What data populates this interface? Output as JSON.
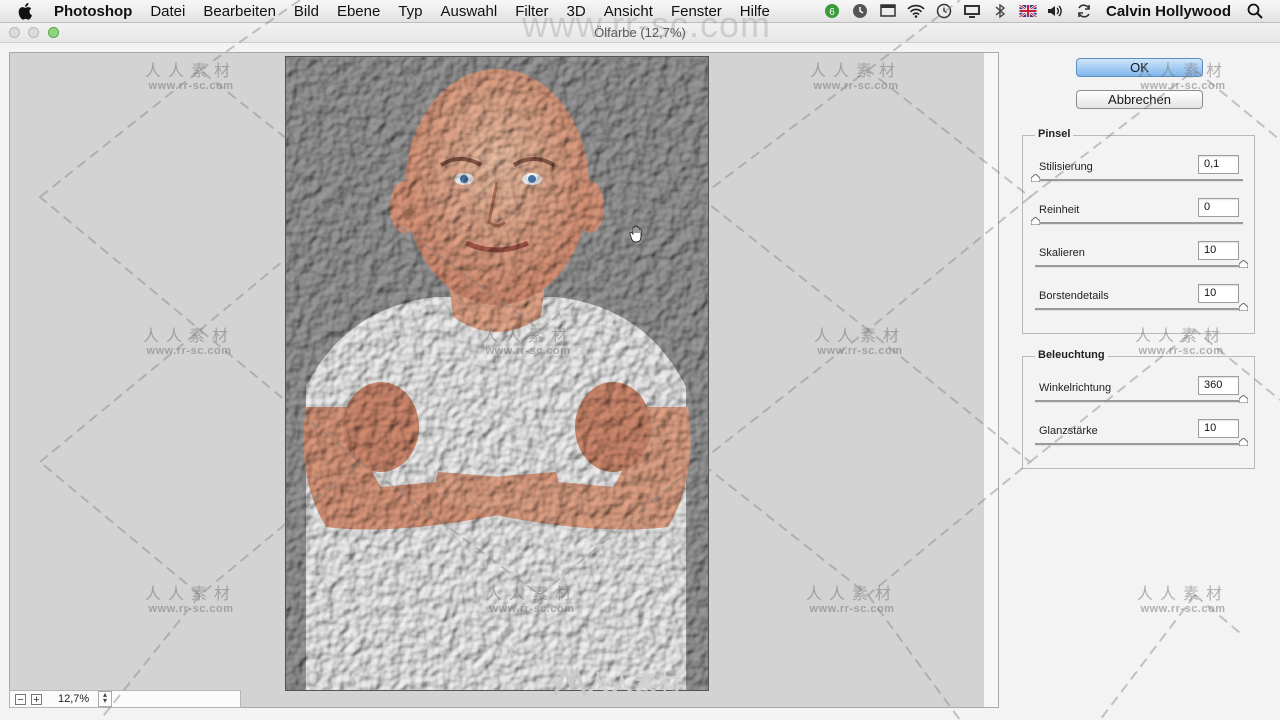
{
  "menubar": {
    "app": "Photoshop",
    "items": [
      "Datei",
      "Bearbeiten",
      "Bild",
      "Ebene",
      "Typ",
      "Auswahl",
      "Filter",
      "3D",
      "Ansicht",
      "Fenster",
      "Hilfe"
    ],
    "user": "Calvin Hollywood",
    "tray_icons": [
      "evernote-icon",
      "clock-icon",
      "window-icon",
      "wifi-icon",
      "time-machine-icon",
      "display-icon",
      "bluetooth-icon",
      "flag-icon",
      "volume-icon",
      "sync-icon"
    ]
  },
  "window": {
    "title": "Ölfarbe (12,7%)"
  },
  "buttons": {
    "ok": "OK",
    "cancel": "Abbrechen"
  },
  "pinsel": {
    "title": "Pinsel",
    "rows": [
      {
        "label": "Stilisierung",
        "value": "0,1",
        "level": 0.0
      },
      {
        "label": "Reinheit",
        "value": "0",
        "level": 0.0
      },
      {
        "label": "Skalieren",
        "value": "10",
        "level": 1.0
      },
      {
        "label": "Borstendetails",
        "value": "10",
        "level": 1.0
      }
    ]
  },
  "beleuchtung": {
    "title": "Beleuchtung",
    "rows": [
      {
        "label": "Winkelrichtung",
        "value": "360",
        "level": 1.0
      },
      {
        "label": "Glanzstärke",
        "value": "10",
        "level": 1.0
      }
    ]
  },
  "zoom": {
    "value": "12,7%",
    "minus": "−",
    "plus": "+"
  },
  "watermark": {
    "cn": "人人素材",
    "url": "www.rr-sc.com",
    "logo": "人人素材",
    "top_url": "www.rr-sc.com"
  },
  "colors": {
    "ok_button": "#7fb6ec",
    "preview_bg": "#d3d3d3",
    "menubar": "#e8e8e8"
  }
}
